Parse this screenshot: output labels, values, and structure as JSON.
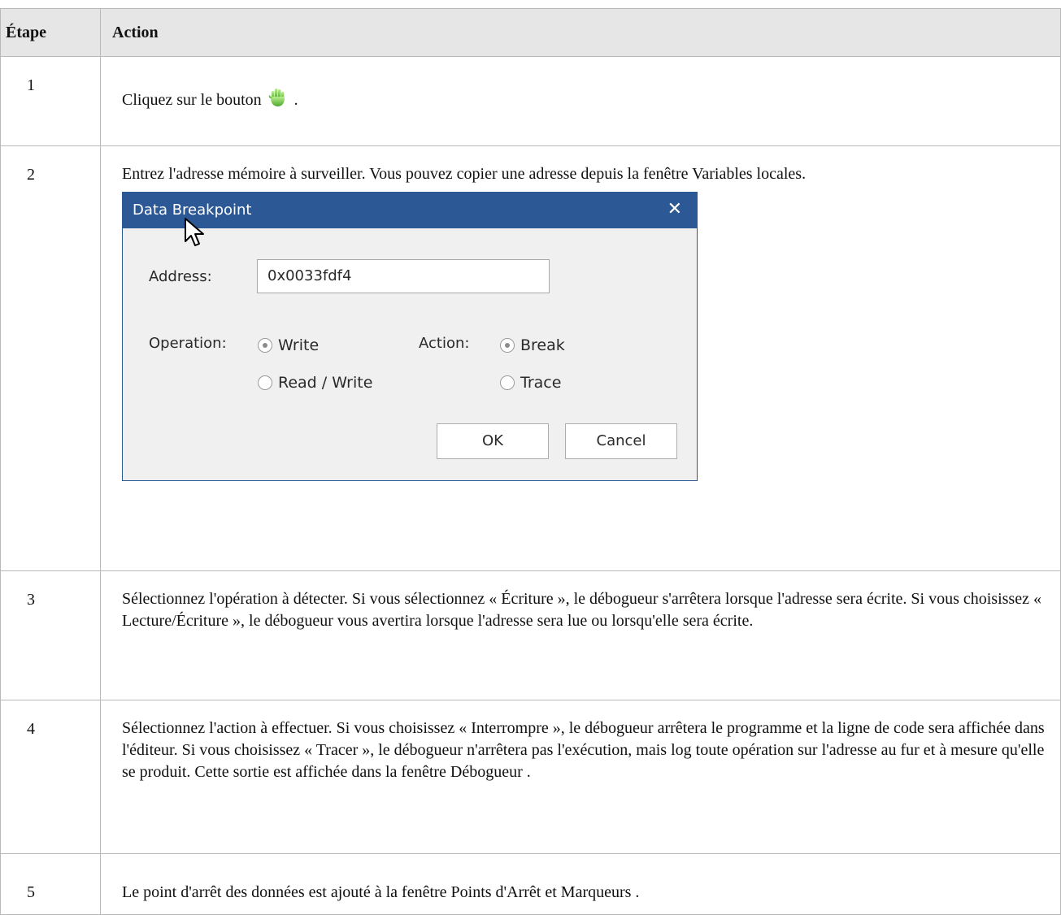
{
  "table": {
    "headers": {
      "step": "Étape",
      "action": "Action"
    },
    "rows": [
      {
        "step": "1",
        "text_before": "Cliquez sur le bouton",
        "text_after": "."
      },
      {
        "step": "2",
        "text": "Entrez l'adresse mémoire à surveiller. Vous pouvez copier une adresse depuis la fenêtre Variables locales."
      },
      {
        "step": "3",
        "text": "Sélectionnez l'opération à détecter. Si vous sélectionnez « Écriture », le débogueur s'arrêtera lorsque l'adresse sera écrite. Si vous choisissez « Lecture/Écriture », le débogueur vous avertira lorsque l'adresse sera lue ou lorsqu'elle sera écrite."
      },
      {
        "step": "4",
        "text": "Sélectionnez l'action à effectuer. Si vous choisissez « Interrompre », le débogueur arrêtera le programme et la ligne de code sera affichée dans l'éditeur. Si vous choisissez « Tracer », le débogueur n'arrêtera pas l'exécution, mais log toute opération sur l'adresse au fur et à mesure qu'elle se produit. Cette sortie est affichée dans la fenêtre Débogueur ."
      },
      {
        "step": "5",
        "text": "Le point d'arrêt des données est ajouté à la fenêtre Points d'Arrêt et Marqueurs ."
      }
    ]
  },
  "icons": {
    "step1_button": "hand-stop-icon",
    "close": "close-icon",
    "cursor": "mouse-cursor-icon"
  },
  "dialog": {
    "title": "Data Breakpoint",
    "close_label": "✕",
    "address_label": "Address:",
    "address_value": "0x0033fdf4",
    "operation_label": "Operation:",
    "operation_options": [
      {
        "label": "Write",
        "selected": true
      },
      {
        "label": "Read / Write",
        "selected": false
      }
    ],
    "action_label": "Action:",
    "action_options": [
      {
        "label": "Break",
        "selected": true
      },
      {
        "label": "Trace",
        "selected": false
      }
    ],
    "ok_label": "OK",
    "cancel_label": "Cancel"
  },
  "colors": {
    "dialog_title_bg": "#2c5896",
    "header_bg": "#e6e6e6",
    "border": "#b9b9b9",
    "hand_icon": "#6cc24a"
  }
}
